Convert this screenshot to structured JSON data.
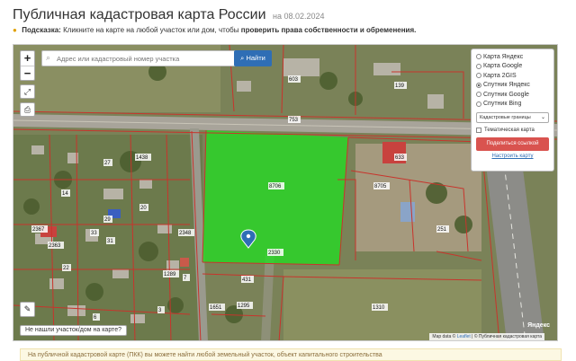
{
  "header": {
    "title": "Публичная кадастровая карта России",
    "date": "на 08.02.2024",
    "hint_label": "Подсказка:",
    "hint_text": "Кликните на карте на любой участок или дом, чтобы",
    "hint_bold": "проверить права собственности и обременения."
  },
  "search": {
    "placeholder": "Адрес или кадастровый номер участка",
    "button_label": "Найти"
  },
  "zoom": {
    "plus": "+",
    "minus": "−"
  },
  "layers": {
    "options": [
      {
        "label": "Карта Яндекс",
        "selected": false
      },
      {
        "label": "Карта Google",
        "selected": false
      },
      {
        "label": "Карта 2GIS",
        "selected": false
      },
      {
        "label": "Спутник Яндекс",
        "selected": true
      },
      {
        "label": "Спутник Google",
        "selected": false
      },
      {
        "label": "Спутник Bing",
        "selected": false
      }
    ],
    "boundaries_select": "Кадастровые границы",
    "thematic_label": "Тематическая карта",
    "share_label": "Поделиться ссылкой",
    "customize_label": "Настроить карту"
  },
  "map": {
    "not_found_label": "Не нашли участок/дом на карте?",
    "attribution_link": "Leaflet",
    "attribution_text": "| © Публичная кадастровая карта",
    "attribution_prefix": "Map data ©",
    "yandex_mark": "Яндекс",
    "labels": {
      "l753": "753",
      "l603": "603",
      "l139": "139",
      "l1438": "1438",
      "l27": "27",
      "l8706": "8706",
      "l8705": "8705",
      "l633": "633",
      "l14": "14",
      "l20": "20",
      "l2363": "2363",
      "l33": "33",
      "l31": "31",
      "l22": "22",
      "l2348": "2348",
      "l1289": "1289",
      "l2330": "2330",
      "l431": "431",
      "l1651": "1651",
      "l1295": "1295",
      "l1310": "1310",
      "l251": "251",
      "l3": "3",
      "l29": "29",
      "l6": "6",
      "l7": "7",
      "l2367": "2367"
    }
  },
  "footer": {
    "note": "На публичной кадастровой карте (ПКК) вы можете найти любой земельный участок, объект капитального строительства"
  },
  "colors": {
    "highlight": "#22dd22",
    "boundary": "#c8342c",
    "button_blue": "#2f6eb5",
    "share_red": "#d9534f"
  }
}
